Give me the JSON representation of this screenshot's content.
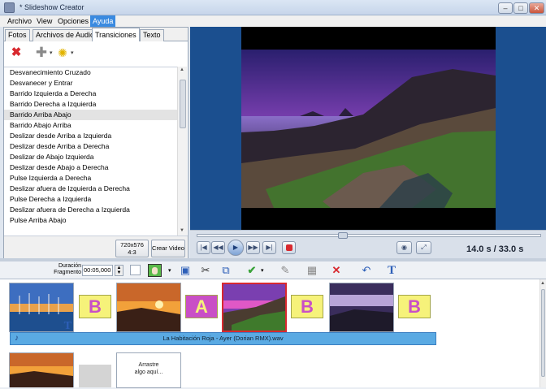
{
  "window": {
    "title": "* Slideshow Creator",
    "controls": {
      "minimize": "–",
      "maximize": "□",
      "close": "✕"
    }
  },
  "menu": {
    "items": [
      {
        "label": "Archivo"
      },
      {
        "label": "View"
      },
      {
        "label": "Opciones"
      },
      {
        "label": "Ayuda",
        "active": true
      }
    ]
  },
  "tabs": [
    {
      "label": "Fotos"
    },
    {
      "label": "Archivos de Audio"
    },
    {
      "label": "Transiciones",
      "selected": true
    },
    {
      "label": "Texto"
    }
  ],
  "transitions": {
    "items": [
      "Desvanecimiento Cruzado",
      "Desvanecer y Entrar",
      "Barrido Izquierda a Derecha",
      "Barrido Derecha a Izquierda",
      "Barrido Arriba Abajo",
      "Barrido Abajo Arriba",
      "Deslizar desde Arriba a Izquierda",
      "Deslizar desde Arriba a Derecha",
      "Deslizar de Abajo Izquierda",
      "Deslizar desde Abajo a Derecha",
      "Pulse Izquierda a Derecha",
      "Deslizar afuera de Izquierda a Derecha",
      "Pulse Derecha a Izquierda",
      "Deslizar afuera de Derecha a Izquierda",
      "Pulse Arriba Abajo"
    ],
    "selected_index": 4
  },
  "left_bottom": {
    "resolution_line1": "720x576",
    "resolution_line2": "4:3",
    "create_video": "Crear Video"
  },
  "player": {
    "time": "14.0 s  / 33.0 s",
    "seek_fraction": 0.42
  },
  "toolbar2": {
    "duration_label1": "Duración",
    "duration_label2": "Fragmento",
    "duration_value": "00:05,000"
  },
  "storyboard": {
    "transitions": [
      "B",
      "A",
      "B",
      "B"
    ],
    "audio_track": "La Habitación Roja - Ayer (Dorian RMX).wav",
    "drop_placeholder_line1": "Arrastre",
    "drop_placeholder_line2": "algo aquí..."
  },
  "colors": {
    "accent": "#3a8ae0",
    "preview_bg": "#1b4f8f",
    "selected_border": "#d8292f",
    "audio_bar": "#5aaae3",
    "transition_b": "#f6f27a",
    "transition_a": "#c94fc6"
  }
}
